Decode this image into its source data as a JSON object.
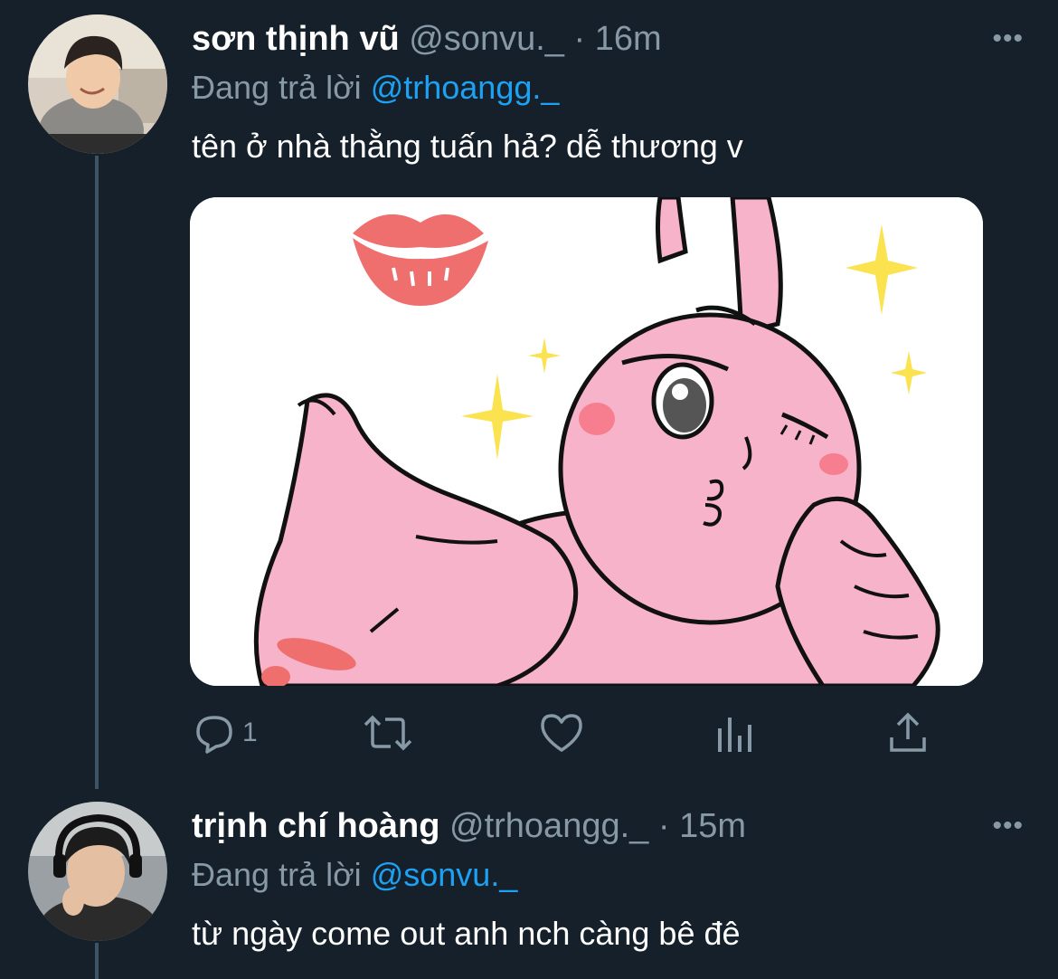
{
  "tweets": [
    {
      "display_name": "sơn thịnh vũ",
      "handle": "@sonvu._",
      "time": "16m",
      "reply_prefix": "Đang trả lời",
      "reply_mention": "@trhoangg._",
      "text": "tên ở nhà thằng tuấn hả? dễ thương v",
      "media_icons": [
        "kiss-lips",
        "pink-rabbit-blowing-kiss",
        "sparkles"
      ],
      "actions": {
        "reply_icon": "reply-icon",
        "reply_count": "1",
        "retweet_icon": "retweet-icon",
        "like_icon": "heart-icon",
        "analytics_icon": "analytics-icon",
        "share_icon": "share-icon"
      },
      "more_label": "•••"
    },
    {
      "display_name": "trịnh chí hoàng",
      "handle": "@trhoangg._",
      "time": "15m",
      "reply_prefix": "Đang trả lời",
      "reply_mention": "@sonvu._",
      "text": "từ ngày come out anh nch càng bê đê",
      "more_label": "•••"
    }
  ],
  "separator": "·",
  "colors": {
    "background": "#15202b",
    "secondary_text": "#8899a6",
    "accent": "#1da1f2",
    "thread_line": "#3d5466",
    "rabbit_pink": "#f7b3c9",
    "sparkle_yellow": "#fbe24f",
    "lips_red": "#ef6f6f"
  }
}
